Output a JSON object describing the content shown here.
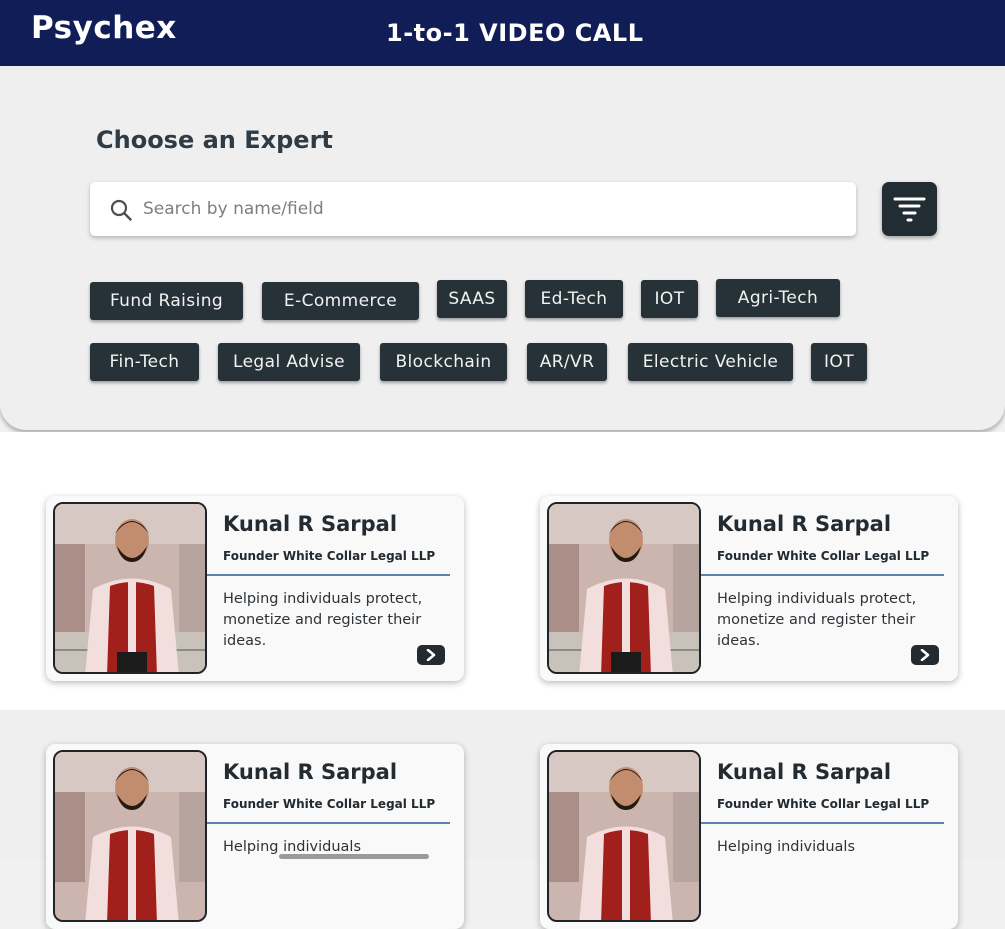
{
  "header": {
    "brand": "Psychex",
    "title": "1-to-1 VIDEO CALL"
  },
  "search_section": {
    "heading": "Choose an Expert",
    "search_placeholder": "Search by name/field",
    "search_value": ""
  },
  "categories": [
    "Fund Raising",
    "E-Commerce",
    "SAAS",
    "Ed-Tech",
    "IOT",
    "Agri-Tech",
    "Fin-Tech",
    "Legal Advise",
    "Blockchain",
    "AR/VR",
    "Electric Vehicle",
    "IOT"
  ],
  "experts": [
    {
      "name": "Kunal R Sarpal",
      "title": "Founder White Collar Legal LLP",
      "description": "Helping individuals protect, monetize and register their ideas."
    },
    {
      "name": "Kunal R Sarpal",
      "title": "Founder White Collar Legal LLP",
      "description": "Helping individuals protect, monetize and register their ideas."
    },
    {
      "name": "Kunal R Sarpal",
      "title": "Founder White Collar Legal LLP",
      "description": "Helping individuals"
    },
    {
      "name": "Kunal R Sarpal",
      "title": "Founder White Collar Legal LLP",
      "description": "Helping individuals"
    }
  ],
  "icons": {
    "search": "search-icon",
    "filter": "filter-icon",
    "next": "chevron-right-icon"
  },
  "colors": {
    "header_bg": "#111d57",
    "chip_bg": "#273238",
    "accent_rule": "#5d7fb3",
    "text_dark": "#232a30"
  }
}
